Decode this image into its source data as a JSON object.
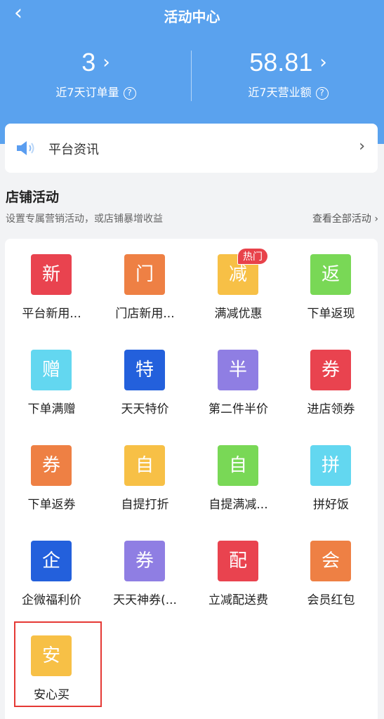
{
  "header": {
    "title": "活动中心",
    "back_icon": "chevron-left-icon",
    "background": "#5aa2ee"
  },
  "stats": [
    {
      "value": "3",
      "label": "近7天订单量"
    },
    {
      "value": "58.81",
      "label": "近7天营业额"
    }
  ],
  "notice": {
    "text": "平台资讯",
    "icon": "speaker-icon"
  },
  "section": {
    "title": "店铺活动",
    "subtitle": "设置专属营销活动，或店铺暴增收益",
    "view_all": "查看全部活动"
  },
  "hot_badge": "热门",
  "activities": [
    {
      "glyph": "新",
      "label": "平台新用...",
      "color": "#e9434f"
    },
    {
      "glyph": "门",
      "label": "门店新用...",
      "color": "#ee8044"
    },
    {
      "glyph": "减",
      "label": "满减优惠",
      "color": "#f7c046"
    },
    {
      "glyph": "返",
      "label": "下单返现",
      "color": "#79d856"
    },
    {
      "glyph": "赠",
      "label": "下单满赠",
      "color": "#63d7f0"
    },
    {
      "glyph": "特",
      "label": "天天特价",
      "color": "#2360dc"
    },
    {
      "glyph": "半",
      "label": "第二件半价",
      "color": "#8f7ee3"
    },
    {
      "glyph": "券",
      "label": "进店领券",
      "color": "#e9434f"
    },
    {
      "glyph": "券",
      "label": "下单返券",
      "color": "#ee8044"
    },
    {
      "glyph": "自",
      "label": "自提打折",
      "color": "#f7c046"
    },
    {
      "glyph": "自",
      "label": "自提满减...",
      "color": "#79d856"
    },
    {
      "glyph": "拼",
      "label": "拼好饭",
      "color": "#63d7f0"
    },
    {
      "glyph": "企",
      "label": "企微福利价",
      "color": "#2360dc"
    },
    {
      "glyph": "券",
      "label": "天天神券(...",
      "color": "#8f7ee3"
    },
    {
      "glyph": "配",
      "label": "立减配送费",
      "color": "#e9434f"
    },
    {
      "glyph": "会",
      "label": "会员红包",
      "color": "#ee8044"
    },
    {
      "glyph": "安",
      "label": "安心买",
      "color": "#f7c046"
    }
  ]
}
